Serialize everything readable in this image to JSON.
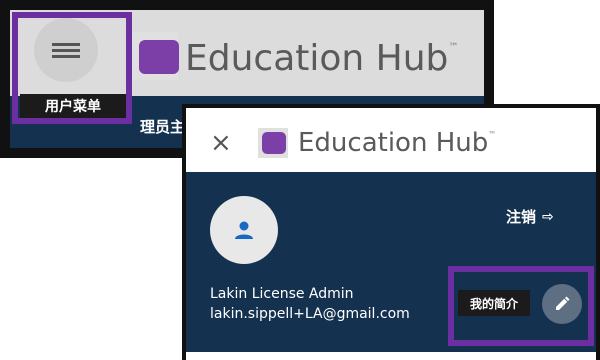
{
  "background_screenshot": {
    "app_title": "Education Hub",
    "trademark": "™",
    "menu_label": "用户菜单",
    "partial_text": "理员主"
  },
  "foreground_screenshot": {
    "close_label": "×",
    "app_title": "Education Hub",
    "trademark": "™",
    "logout_label": "注销",
    "logout_icon": "⇨",
    "user_name": "Lakin License Admin",
    "user_email": "lakin.sippell+LA@gmail.com",
    "profile_label": "我的简介"
  },
  "colors": {
    "navy": "#14314f",
    "purple_highlight": "#6b2fa1",
    "logo_purple": "#7b3fa7"
  },
  "icons": {
    "hamburger": "menu-icon",
    "avatar": "user-icon",
    "edit": "pencil-icon",
    "logout": "logout-icon",
    "close": "close-icon"
  }
}
